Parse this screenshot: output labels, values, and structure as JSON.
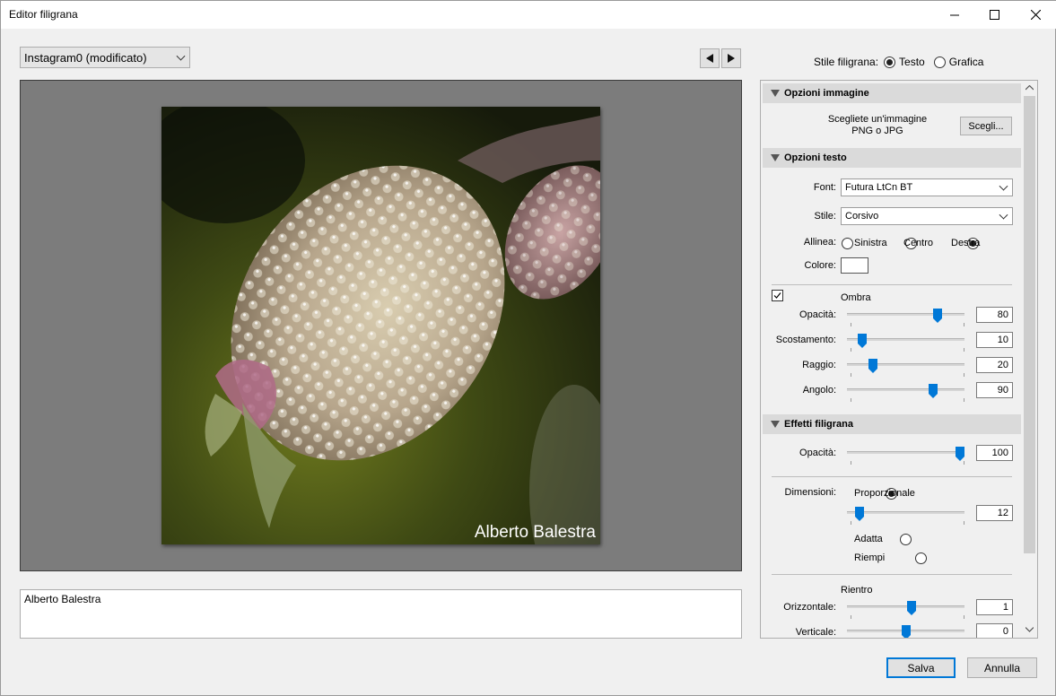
{
  "window": {
    "title": "Editor filigrana"
  },
  "preset": {
    "selected": "Instagram0 (modificato)"
  },
  "watermark_text": "Alberto Balestra",
  "textarea_value": "Alberto Balestra",
  "style": {
    "label": "Stile filigrana:",
    "opt_text": "Testo",
    "opt_graphic": "Grafica",
    "selected": "Testo"
  },
  "image_options": {
    "header": "Opzioni immagine",
    "hint_line1": "Scegliete un'immagine",
    "hint_line2": "PNG o JPG",
    "choose_button": "Scegli..."
  },
  "text_options": {
    "header": "Opzioni testo",
    "font_label": "Font:",
    "font_value": "Futura LtCn BT",
    "style_label": "Stile:",
    "style_value": "Corsivo",
    "align_label": "Allinea:",
    "align_left": "Sinistra",
    "align_center": "Centro",
    "align_right": "Destra",
    "align_selected": "Destra",
    "color_label": "Colore:",
    "color_value": "#ffffff"
  },
  "shadow": {
    "label": "Ombra",
    "enabled": true,
    "opacity_label": "Opacità:",
    "opacity": "80",
    "offset_label": "Scostamento:",
    "offset": "10",
    "radius_label": "Raggio:",
    "radius": "20",
    "angle_label": "Angolo:",
    "angle": "90"
  },
  "effects": {
    "header": "Effetti filigrana",
    "opacity_label": "Opacità:",
    "opacity": "100",
    "dimensions_label": "Dimensioni:",
    "proportional": "Proporzionale",
    "size": "12",
    "fit": "Adatta",
    "fill": "Riempi",
    "size_mode_selected": "Proporzionale",
    "inset_label": "Rientro",
    "horizontal_label": "Orizzontale:",
    "horizontal": "1",
    "vertical_label": "Verticale:",
    "vertical": "0"
  },
  "buttons": {
    "save": "Salva",
    "cancel": "Annulla"
  },
  "colors": {
    "accent": "#0078d7",
    "slider_thumb": "#0078d7"
  }
}
